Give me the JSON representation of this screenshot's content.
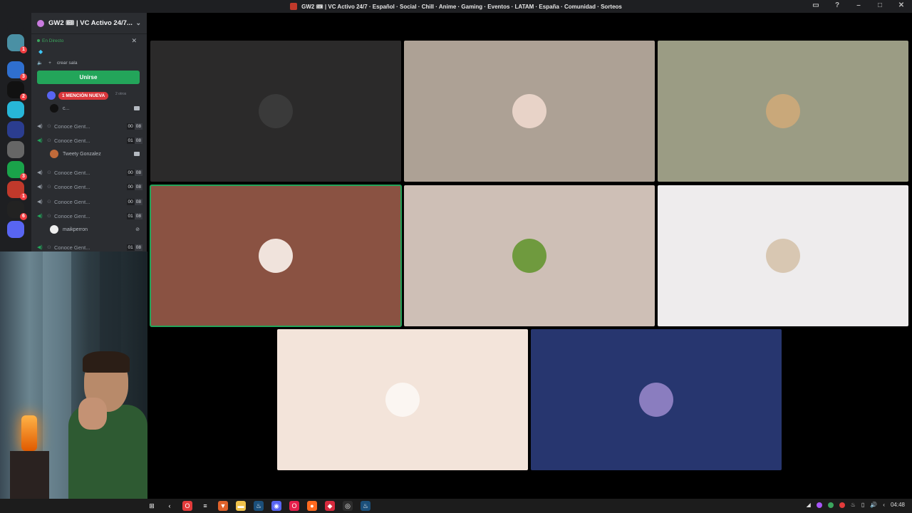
{
  "titlebar": {
    "title": "GW2 🎟 | VC Activo 24/7 · Español · Social · Chill · Anime · Gaming · Eventos · LATAM · España · Comunidad · Sorteos",
    "controls": [
      "inbox-icon",
      "help-icon",
      "minimize-icon",
      "maximize-icon",
      "close-icon"
    ]
  },
  "guilds": [
    {
      "name": "discord-home-icon",
      "color": "#1e1f22",
      "badge": ""
    },
    {
      "name": "guild-1-icon",
      "color": "#4a90a4",
      "badge": "1"
    },
    {
      "name": "guild-2-icon",
      "color": "#2f6fcf",
      "badge": "3"
    },
    {
      "name": "guild-3-icon",
      "color": "#111111",
      "badge": "2"
    },
    {
      "name": "guild-4-icon",
      "color": "#27b6d8",
      "badge": ""
    },
    {
      "name": "guild-5-icon",
      "color": "#2b3d8f",
      "badge": ""
    },
    {
      "name": "guild-6-icon",
      "color": "#666666",
      "badge": ""
    },
    {
      "name": "guild-7-icon",
      "color": "#1aa34a",
      "badge": "3"
    },
    {
      "name": "guild-8-icon",
      "color": "#c0392b",
      "badge": "1"
    },
    {
      "name": "guild-9-icon",
      "color": "#222222",
      "badge": "6"
    },
    {
      "name": "guild-10-icon",
      "color": "#5865f2",
      "badge": ""
    }
  ],
  "sidebar": {
    "server_name": "GW2 🎟 | VC Activo 24/7...",
    "live_label": "En Directo",
    "create_room": "crear sala",
    "join_button": "Unirse",
    "mention_badge": "1 MENCIÓN NUEVA",
    "mention_extra": "2 otros",
    "user_small": "c...",
    "user_tweety": "Tweety Gonzalez",
    "user_maik": "maikperron",
    "channels": [
      {
        "name": "Conoce Gent...",
        "count_a": "00",
        "count_b": "08",
        "active": false
      },
      {
        "name": "Conoce Gent...",
        "count_a": "01",
        "count_b": "08",
        "active": true
      },
      {
        "name": "Conoce Gent...",
        "count_a": "00",
        "count_b": "08",
        "active": false
      },
      {
        "name": "Conoce Gent...",
        "count_a": "00",
        "count_b": "08",
        "active": false
      },
      {
        "name": "Conoce Gent...",
        "count_a": "00",
        "count_b": "08",
        "active": false
      },
      {
        "name": "Conoce Gent...",
        "count_a": "01",
        "count_b": "08",
        "active": true
      },
      {
        "name": "Conoce Gent...",
        "count_a": "01",
        "count_b": "08",
        "active": true
      }
    ]
  },
  "tiles": [
    {
      "bg": "#2b2a2a",
      "avatar": "#3a3a3a",
      "speaking": false
    },
    {
      "bg": "#ada195",
      "avatar": "#e8d3c8",
      "speaking": false
    },
    {
      "bg": "#9b9c84",
      "avatar": "#c9a87a",
      "speaking": false
    },
    {
      "bg": "#8a5242",
      "avatar": "#f0e3dc",
      "speaking": true
    },
    {
      "bg": "#cebfb6",
      "avatar": "#6f9a3e",
      "speaking": false
    },
    {
      "bg": "#eeeced",
      "avatar": "#d8c7b2",
      "speaking": false
    },
    {
      "bg": "#f3e4da",
      "avatar": "#fbf6f2",
      "speaking": false
    },
    {
      "bg": "#27366f",
      "avatar": "#8a7dbf",
      "speaking": false
    }
  ],
  "taskbar": {
    "apps": [
      {
        "name": "start-icon",
        "color": "#1c1c1c",
        "glyph": "⊞"
      },
      {
        "name": "back-icon",
        "color": "#1c1c1c",
        "glyph": "‹"
      },
      {
        "name": "opera-icon",
        "color": "#e23b3b",
        "glyph": "O"
      },
      {
        "name": "taskview-icon",
        "color": "#1c1c1c",
        "glyph": "≡"
      },
      {
        "name": "brave-icon",
        "color": "#e0622b",
        "glyph": "▼"
      },
      {
        "name": "file-explorer-icon",
        "color": "#f0c24b",
        "glyph": "▬"
      },
      {
        "name": "steam-icon",
        "color": "#1b4f7a",
        "glyph": "♨"
      },
      {
        "name": "discord-icon",
        "color": "#5865f2",
        "glyph": "◉"
      },
      {
        "name": "opera-gx-icon",
        "color": "#e51f4c",
        "glyph": "O"
      },
      {
        "name": "firefox-icon",
        "color": "#ff6a1f",
        "glyph": "●"
      },
      {
        "name": "app-red-icon",
        "color": "#d62b3e",
        "glyph": "◆"
      },
      {
        "name": "obs-icon",
        "color": "#2d2d2d",
        "glyph": "◎"
      },
      {
        "name": "steam-2-icon",
        "color": "#1b4f7a",
        "glyph": "♨"
      }
    ],
    "clock": "04:48"
  }
}
